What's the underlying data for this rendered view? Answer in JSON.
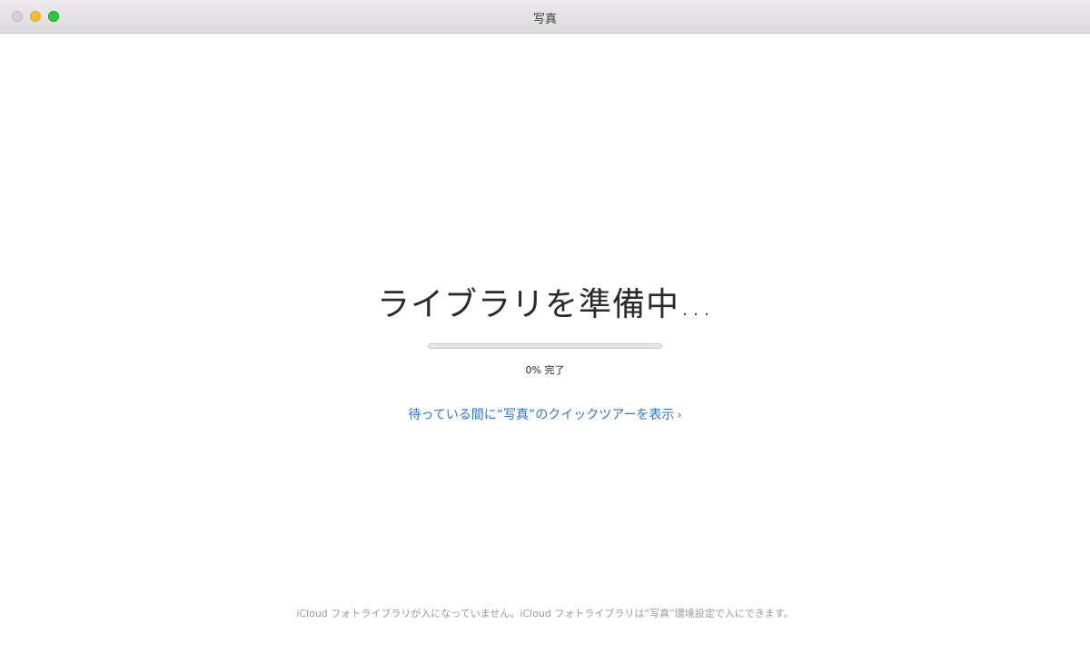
{
  "window": {
    "title": "写真"
  },
  "main": {
    "heading": "ライブラリを準備中…",
    "progress": {
      "percent": 0,
      "label": "0% 完了"
    },
    "tour_link": "待っている間に“写真”のクイックツアーを表示",
    "tour_link_chevron": "›"
  },
  "footer": {
    "note": "iCloud フォトライブラリが入になっていません。iCloud フォトライブラリは“写真”環境設定で入にできます。"
  },
  "colors": {
    "accent": "#2f72d8",
    "progress_fill": "#5a9cf2",
    "close": "#d4d2d4",
    "minimize": "#f6be2f",
    "zoom": "#29c940"
  }
}
